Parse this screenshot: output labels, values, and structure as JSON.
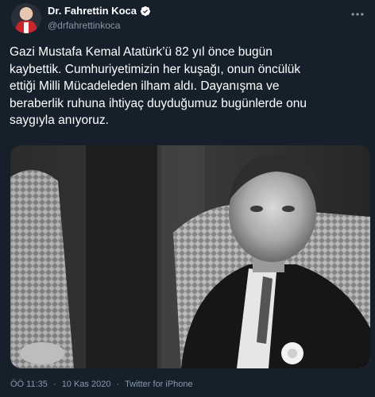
{
  "author": {
    "display_name": "Dr. Fahrettin Koca",
    "handle": "@drfahrettinkoca"
  },
  "tweet": {
    "text": "Gazi Mustafa Kemal Atatürk’ü 82 yıl önce bugün\nkaybettik. Cumhuriyetimizin her kuşağı, onun öncülük\nettiği Milli Mücadeleden ilham aldı. Dayanışma ve\nberaberlik ruhuna ihtiyaç duyduğumuz bugünlerde onu\nsaygıyla anıyoruz."
  },
  "meta": {
    "time": "ÖÖ 11:35",
    "sep1": "·",
    "date": "10 Kas 2020",
    "sep2": "·",
    "source": "Twitter for iPhone"
  },
  "colors": {
    "background": "#15202b",
    "secondary_text": "#8899a6",
    "verified_badge": "#ffffff"
  },
  "icons": {
    "verified": "verified-badge-icon",
    "more": "more-options-icon"
  }
}
